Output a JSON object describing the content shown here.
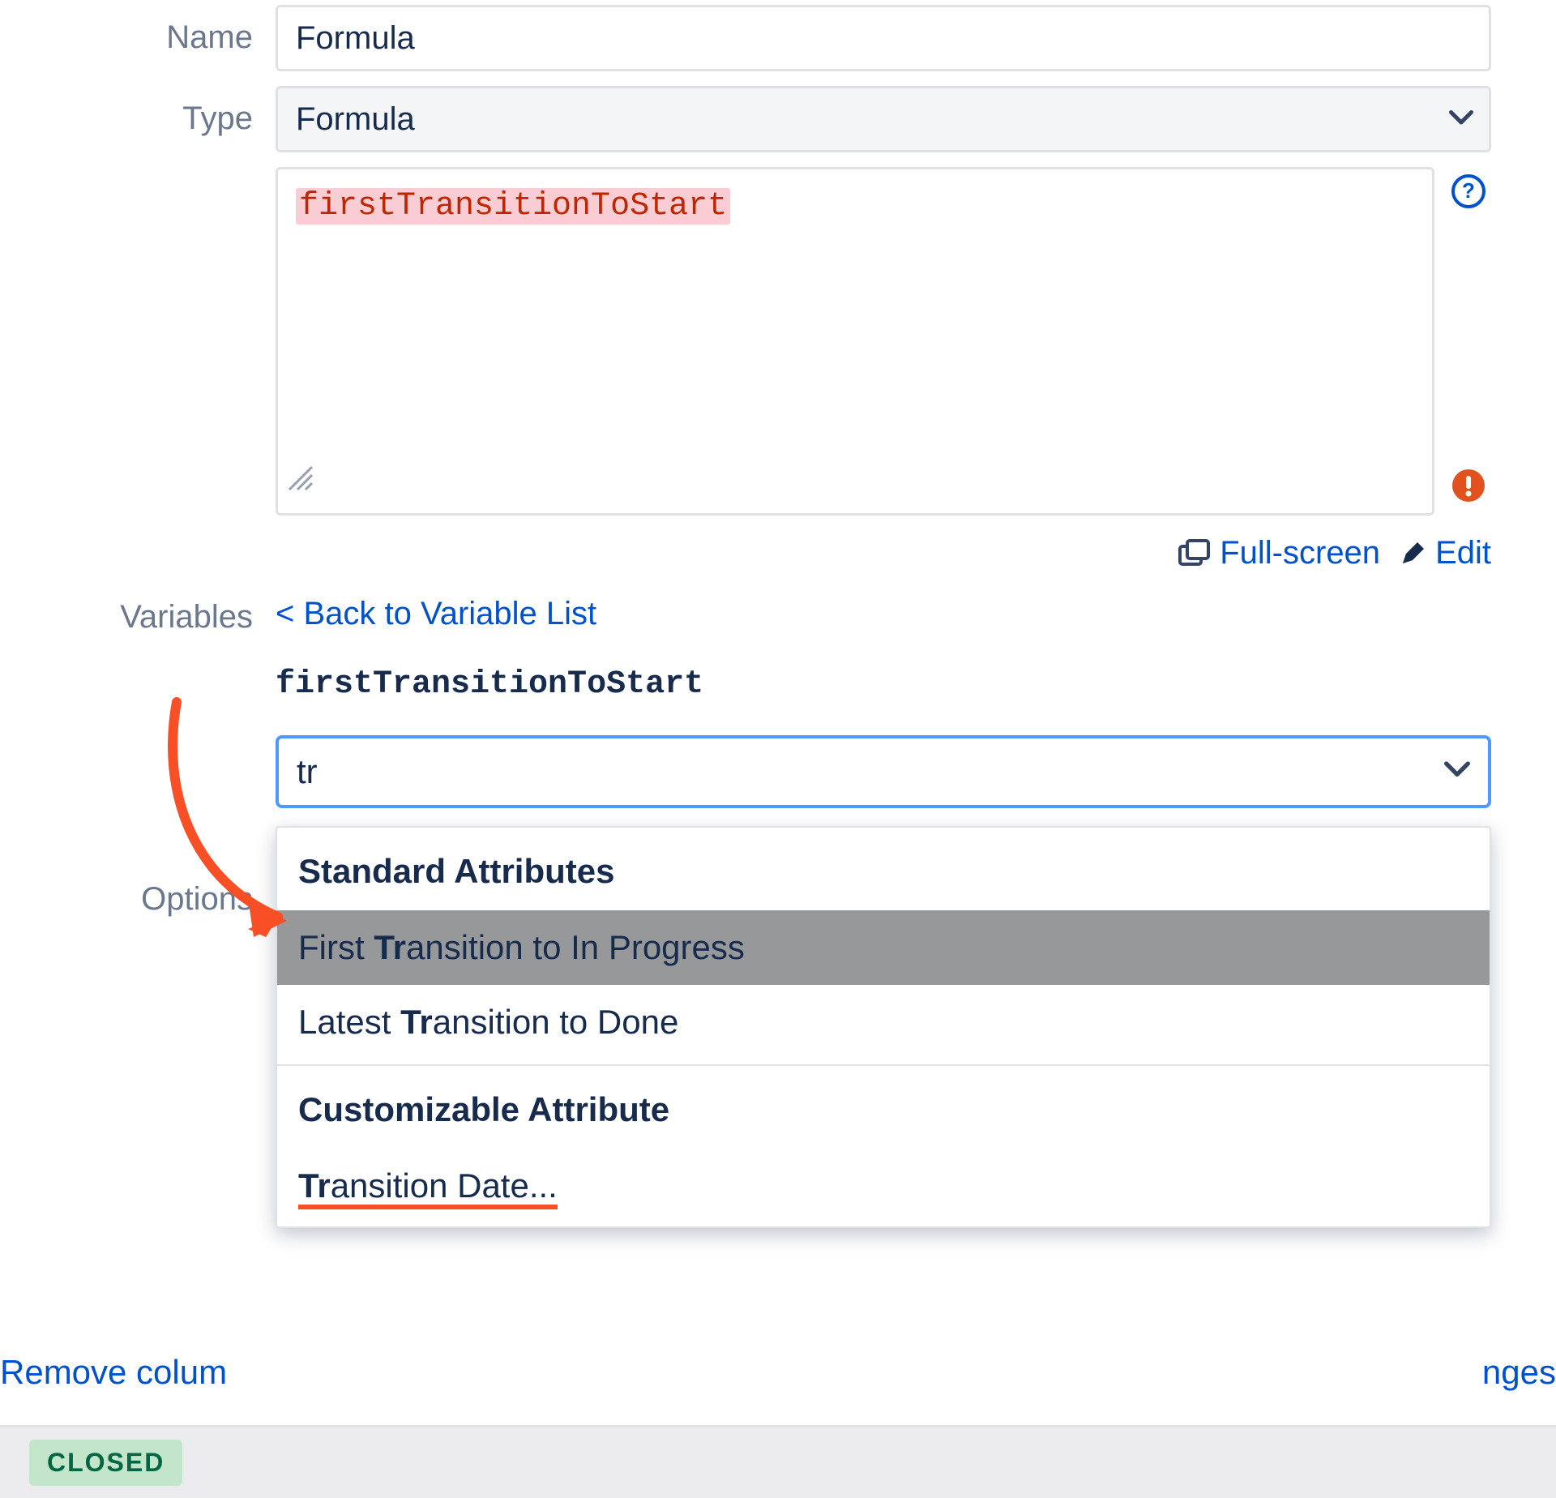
{
  "form": {
    "name_label": "Name",
    "name_value": "Formula",
    "type_label": "Type",
    "type_value": "Formula",
    "formula_text": "firstTransitionToStart",
    "fullscreen_label": "Full-screen",
    "edit_label": "Edit"
  },
  "variables": {
    "section_label": "Variables",
    "back_link": "< Back to Variable List",
    "var_name": "firstTransitionToStart",
    "search_value": "tr",
    "options_label": "Options",
    "dropdown": {
      "group1": "Standard Attributes",
      "opt1_prefix": "First ",
      "opt1_bold": "Tr",
      "opt1_rest": "ansition to In Progress",
      "opt2_prefix": "Latest ",
      "opt2_bold": "Tr",
      "opt2_rest": "ansition to Done",
      "group2": "Customizable Attribute",
      "opt3_bold": "Tr",
      "opt3_rest": "ansition Date..."
    }
  },
  "bg": {
    "remove_fragment": "Remove colum",
    "changes_fragment": "nges",
    "closed_badge": "CLOSED"
  }
}
